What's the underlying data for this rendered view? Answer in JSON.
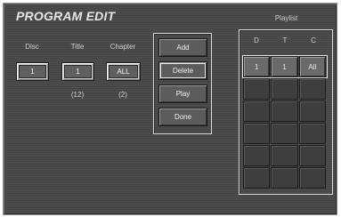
{
  "window": {
    "title": "PROGRAM EDIT"
  },
  "selectors": {
    "disc": {
      "label": "Disc",
      "value": "1",
      "count": ""
    },
    "title": {
      "label": "Title",
      "value": "1",
      "count": "(12)"
    },
    "chapter": {
      "label": "Chapter",
      "value": "ALL",
      "count": "(2)"
    }
  },
  "actions": {
    "add": "Add",
    "delete": "Delete",
    "play": "Play",
    "done": "Done"
  },
  "playlist": {
    "title": "Playlist",
    "columns": [
      "D",
      "T",
      "C"
    ],
    "rows": [
      [
        "1",
        "1",
        "All"
      ],
      [
        "",
        "",
        ""
      ],
      [
        "",
        "",
        ""
      ],
      [
        "",
        "",
        ""
      ],
      [
        "",
        "",
        ""
      ],
      [
        "",
        "",
        ""
      ],
      [
        "",
        "",
        ""
      ]
    ]
  }
}
